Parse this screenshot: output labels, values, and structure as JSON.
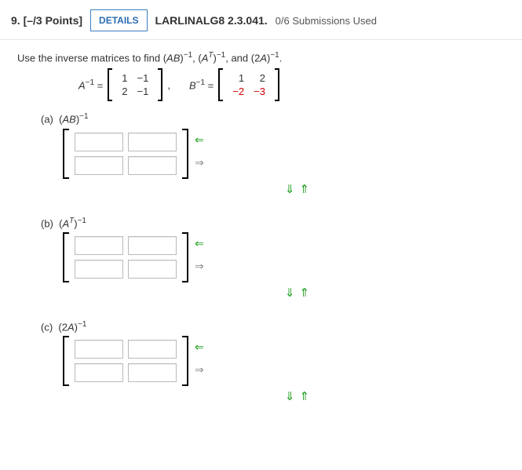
{
  "header": {
    "number": "9.",
    "points": "[–/3 Points]",
    "details_label": "DETAILS",
    "source": "LARLINALG8 2.3.041.",
    "submissions": "0/6 Submissions Used"
  },
  "instruction_prefix": "Use the inverse matrices to find (",
  "instruction_mid1": ")",
  "instruction_mid2": ", (",
  "instruction_mid3": ")",
  "instruction_mid4": ", and (2",
  "instruction_mid5": ")",
  "instruction_end": ".",
  "exp_neg1": "−1",
  "sym_AB": "AB",
  "sym_AT": "A",
  "sym_T": "T",
  "sym_A": "A",
  "matA": {
    "label_pre": "A",
    "eq": " = ",
    "r1c1": "1",
    "r1c2": "−1",
    "r2c1": "2",
    "r2c2": "−1",
    "comma": ","
  },
  "matB": {
    "label_pre": "B",
    "eq": " = ",
    "r1c1": "1",
    "r1c2": "2",
    "r2c1": "−2",
    "r2c2": "−3"
  },
  "parts": {
    "a": {
      "label": "(a)",
      "expr_pre": "(",
      "expr_mid": "AB",
      "expr_post": ")"
    },
    "b": {
      "label": "(b)",
      "expr_pre": "(",
      "expr_mid": "A",
      "expr_post": ")"
    },
    "c": {
      "label": "(c)",
      "expr_pre": "(2",
      "expr_mid": "A",
      "expr_post": ")"
    }
  },
  "arrows": {
    "left": "⇐",
    "right": "⇒",
    "down": "⇓",
    "up": "⇑"
  }
}
